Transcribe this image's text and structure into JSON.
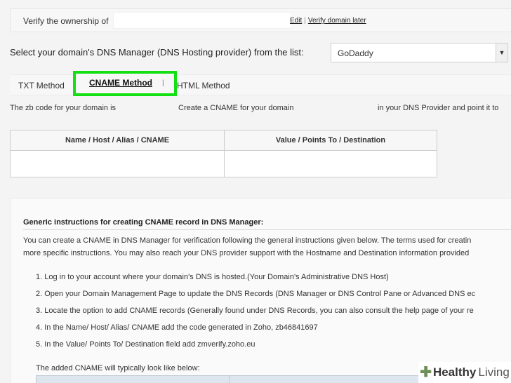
{
  "verify": {
    "prefix": "Verify the ownership of",
    "domain_value": "",
    "edit_link": "Edit",
    "separator": "|",
    "later_link": "Verify domain later"
  },
  "dns_manager": {
    "label": "Select your domain's DNS Manager (DNS Hosting provider) from the list:",
    "selected": "GoDaddy",
    "arrow_icon": "chevron-down-icon"
  },
  "tabs": [
    {
      "label": "TXT Method",
      "active": false
    },
    {
      "label": "CNAME Method",
      "active": true
    },
    {
      "label": "HTML Method",
      "active": false
    }
  ],
  "tab_separator": "|",
  "highlight_color": "#12e012",
  "zb_line": {
    "part1": "The zb code for your domain is",
    "part2": "Create a CNAME for your domain",
    "part3": "in your DNS Provider and point it to"
  },
  "cname_table": {
    "headers": [
      "Name / Host / Alias / CNAME",
      "Value / Points To / Destination"
    ],
    "rows": [
      [
        "",
        ""
      ]
    ]
  },
  "instructions": {
    "heading": "Generic instructions for creating CNAME record in DNS Manager:",
    "para_line1": "You can create a CNAME in DNS Manager for verification following the general instructions given below. The terms used for creatin",
    "para_line2": "more specific instructions. You may also reach your DNS provider support with the Hostname and Destination information provided",
    "steps": [
      "1. Log in to your account where your domain's DNS is hosted.(Your Domain's Administrative DNS Host)",
      "2. Open your Domain Management Page to update the DNS Records (DNS Manager or DNS Control Pane or Advanced DNS ec",
      "3. Locate the option to add CNAME records (Generally found under DNS Records, you can also consult the help page of your re",
      "4. In the Name/ Host/ Alias/ CNAME add the code generated in Zoho, zb46841697",
      "5. In the Value/ Points To/ Destination field add zmverify.zoho.eu"
    ],
    "footer": "The added CNAME will typically look like below:"
  },
  "watermark": {
    "bold": "Healthy",
    "light": "Living"
  }
}
